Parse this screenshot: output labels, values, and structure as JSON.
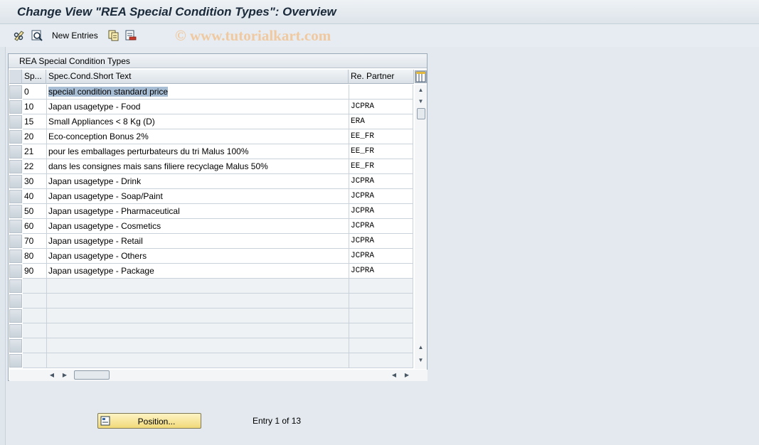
{
  "title": "Change View \"REA Special Condition Types\": Overview",
  "toolbar": {
    "new_entries_label": "New Entries",
    "icons": [
      "edit-glasses-icon",
      "details-icon",
      "copy-icon",
      "delete-icon"
    ]
  },
  "watermark": "© www.tutorialkart.com",
  "table": {
    "title": "REA Special Condition Types",
    "columns": [
      "Sp...",
      "Spec.Cond.Short Text",
      "Re. Partner"
    ],
    "rows": [
      {
        "code": "0",
        "text": "special condition standard price",
        "partner": ""
      },
      {
        "code": "10",
        "text": "Japan usagetype - Food",
        "partner": "JCPRA"
      },
      {
        "code": "15",
        "text": "Small Appliances < 8 Kg (D)",
        "partner": "ERA"
      },
      {
        "code": "20",
        "text": "Eco-conception Bonus 2%",
        "partner": "EE_FR"
      },
      {
        "code": "21",
        "text": "pour les emballages perturbateurs du tri Malus 100%",
        "partner": "EE_FR"
      },
      {
        "code": "22",
        "text": "dans les consignes mais sans filiere recyclage Malus 50%",
        "partner": "EE_FR"
      },
      {
        "code": "30",
        "text": "Japan usagetype - Drink",
        "partner": "JCPRA"
      },
      {
        "code": "40",
        "text": "Japan usagetype - Soap/Paint",
        "partner": "JCPRA"
      },
      {
        "code": "50",
        "text": "Japan usagetype - Pharmaceutical",
        "partner": "JCPRA"
      },
      {
        "code": "60",
        "text": "Japan usagetype - Cosmetics",
        "partner": "JCPRA"
      },
      {
        "code": "70",
        "text": "Japan usagetype - Retail",
        "partner": "JCPRA"
      },
      {
        "code": "80",
        "text": "Japan usagetype - Others",
        "partner": "JCPRA"
      },
      {
        "code": "90",
        "text": "Japan usagetype - Package",
        "partner": "JCPRA"
      }
    ],
    "empty_rows": 6
  },
  "position_button_label": "Position...",
  "entry_status": "Entry 1 of 13",
  "colors": {
    "accent_button": "#f1d979",
    "selection": "#a7bdd4",
    "background": "#dfe6ec"
  }
}
